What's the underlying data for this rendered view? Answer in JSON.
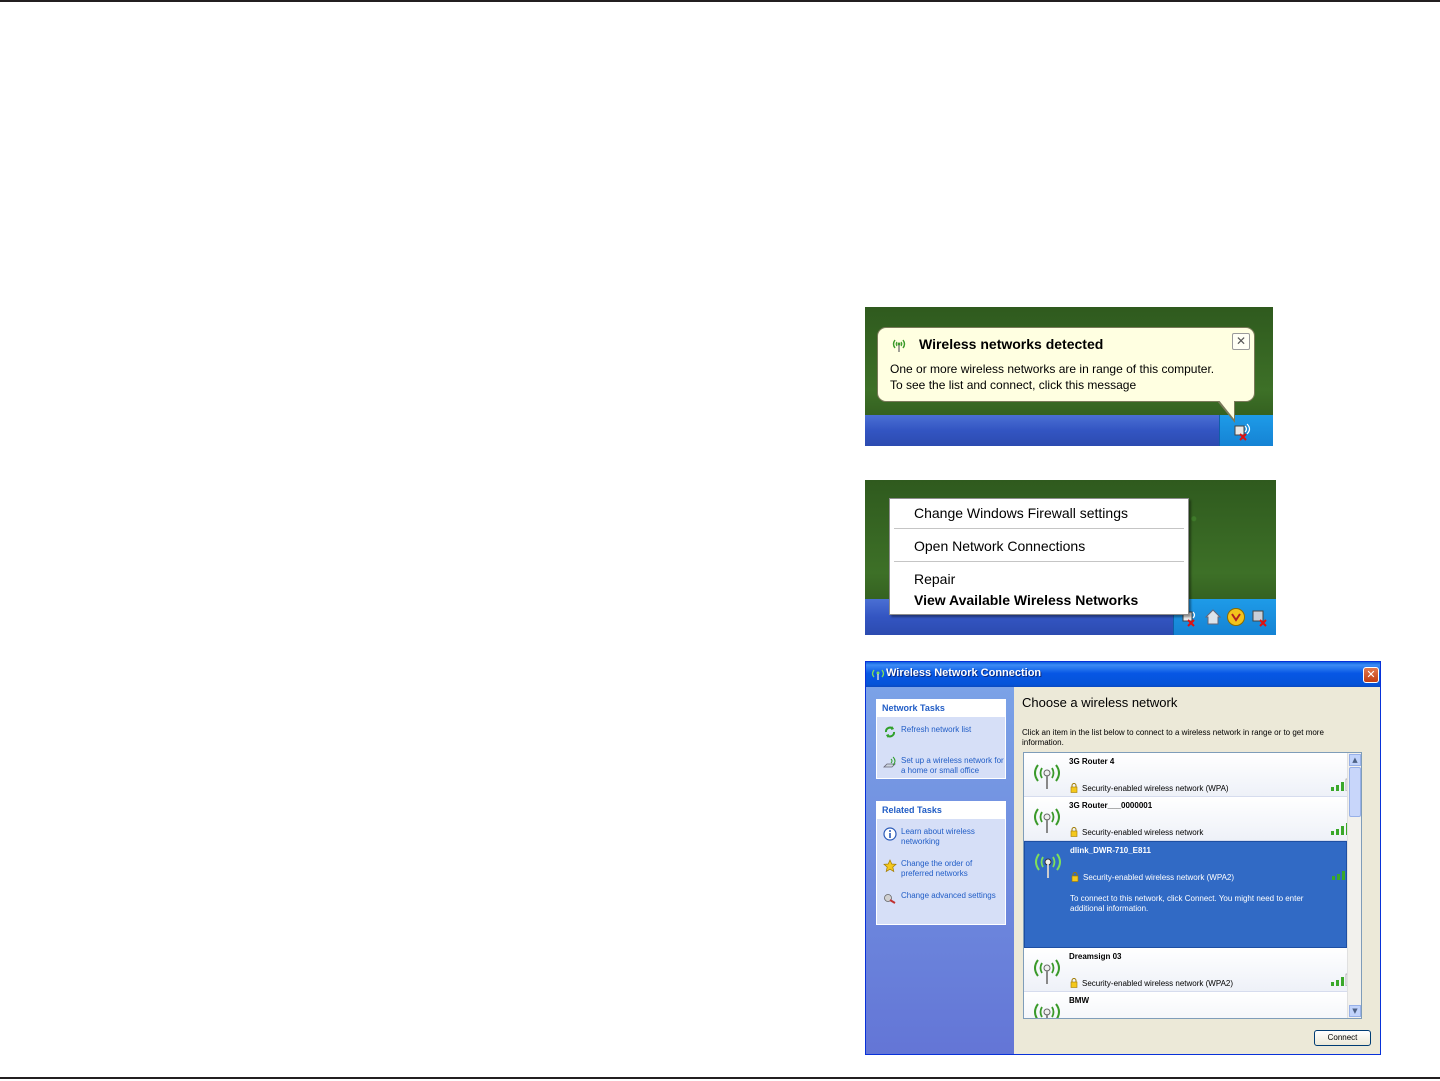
{
  "balloon": {
    "title": "Wireless networks detected",
    "close_glyph": "✕",
    "line1": "One or more wireless networks are in range of this computer.",
    "line2": "To see the list and connect, click this message",
    "icon": "wireless-antenna-icon"
  },
  "context_menu": {
    "items": [
      "Change Windows Firewall settings",
      "Open Network Connections",
      "Repair",
      "View Available Wireless Networks"
    ],
    "default_item": "View Available Wireless Networks"
  },
  "window": {
    "title": "Wireless Network Connection",
    "close_glyph": "✕",
    "network_tasks": {
      "header": "Network Tasks",
      "items": [
        {
          "label": "Refresh network list",
          "icon": "refresh-icon"
        },
        {
          "label": "Set up a wireless network for a home or small office",
          "icon": "setup-wireless-icon"
        }
      ]
    },
    "related_tasks": {
      "header": "Related Tasks",
      "items": [
        {
          "label": "Learn about wireless networking",
          "icon": "info-icon"
        },
        {
          "label": "Change the order of preferred networks",
          "icon": "star-icon"
        },
        {
          "label": "Change advanced settings",
          "icon": "settings-icon"
        }
      ]
    },
    "heading": "Choose a wireless network",
    "description": "Click an item in the list below to connect to a wireless network in range or to get more information.",
    "networks": [
      {
        "name": "3G Router 4",
        "security": "Security-enabled wireless network (WPA)",
        "selected": false
      },
      {
        "name": "3G Router___0000001",
        "security": "Security-enabled wireless network",
        "selected": false
      },
      {
        "name": "dlink_DWR-710_E811",
        "security": "Security-enabled wireless network (WPA2)",
        "selected": true,
        "hint": "To connect to this network, click Connect. You might need to enter additional information."
      },
      {
        "name": "Dreamsign 03",
        "security": "Security-enabled wireless network (WPA2)",
        "selected": false
      },
      {
        "name": "BMW",
        "security": "",
        "selected": false
      }
    ],
    "connect_label": "Connect"
  },
  "colors": {
    "balloon_bg": "#ffffe1",
    "taskbar_blue": "#3355c2",
    "tray_blue": "#1583d4",
    "selection_blue": "#316ac5",
    "task_link": "#215dc6"
  }
}
